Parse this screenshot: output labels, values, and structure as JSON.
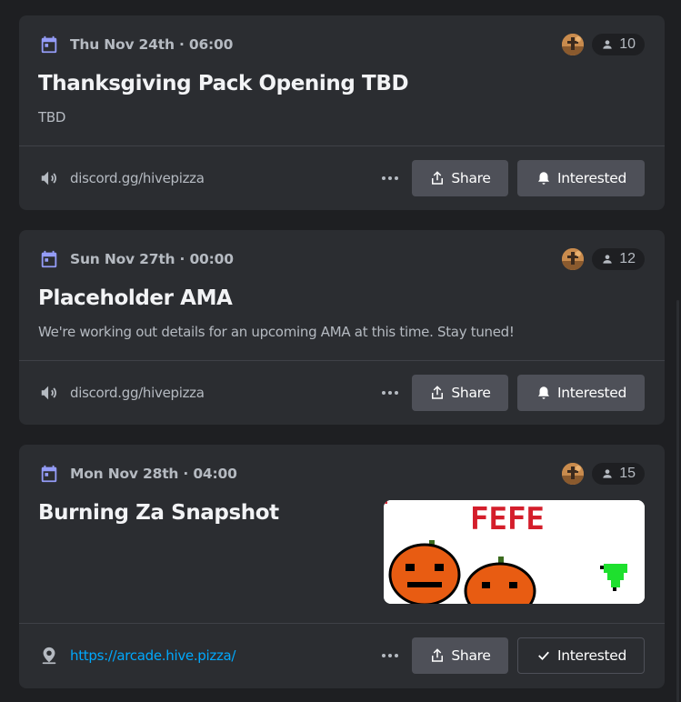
{
  "events": [
    {
      "date": "Thu Nov 24th · 06:00",
      "title": "Thanksgiving Pack Opening TBD",
      "description": "TBD",
      "interested_count": "10",
      "location": "discord.gg/hivepizza",
      "location_type": "voice",
      "share_label": "Share",
      "interested_label": "Interested",
      "interested_active": false
    },
    {
      "date": "Sun Nov 27th · 00:00",
      "title": "Placeholder AMA",
      "description": "We're working out details for an upcoming AMA at this time. Stay tuned!",
      "interested_count": "12",
      "location": "discord.gg/hivepizza",
      "location_type": "voice",
      "share_label": "Share",
      "interested_label": "Interested",
      "interested_active": false
    },
    {
      "date": "Mon Nov 28th · 04:00",
      "title": "Burning Za Snapshot",
      "description": "",
      "interested_count": "15",
      "location": "https://arcade.hive.pizza/",
      "location_type": "external",
      "share_label": "Share",
      "interested_label": "Interested",
      "interested_active": true,
      "image_text": "FEFE"
    }
  ],
  "colors": {
    "background": "#1e1f22",
    "card": "#2b2d31",
    "accent_calendar": "#949cf7",
    "button": "#4e5058",
    "link": "#00a8fc"
  },
  "icons": {
    "calendar": "calendar-icon",
    "people": "people-icon",
    "voice": "speaker-icon",
    "external": "location-pin-icon",
    "share": "share-icon",
    "interested": "bell-icon",
    "interested_active": "checkmark-icon",
    "more": "more-icon"
  }
}
